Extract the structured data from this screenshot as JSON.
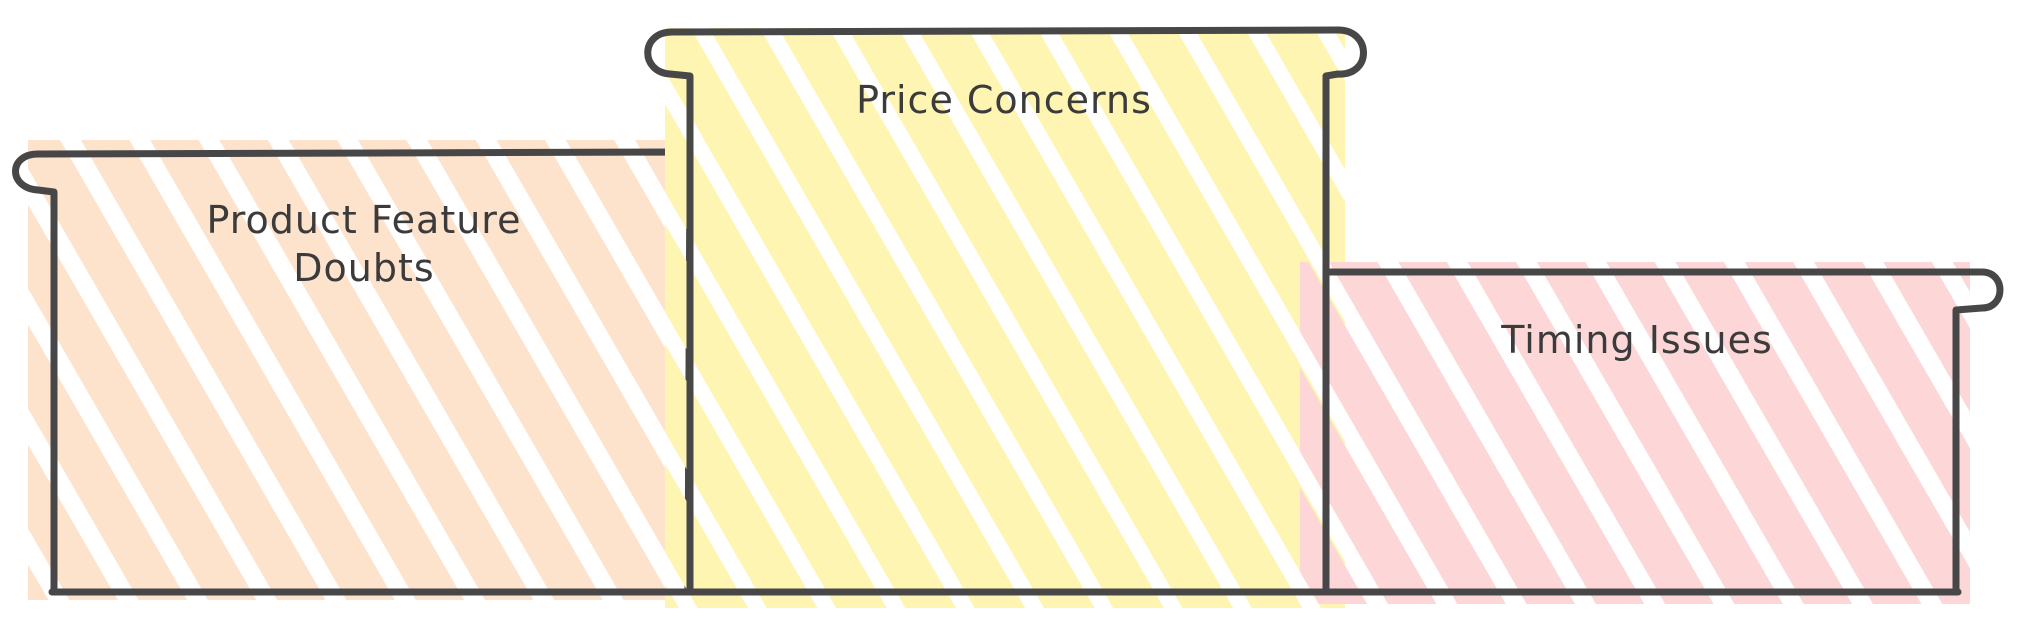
{
  "podium": [
    {
      "key": "left",
      "label": "Product Feature\nDoubts",
      "rank": 2,
      "fill": "#fde2cc"
    },
    {
      "key": "center",
      "label": "Price Concerns",
      "rank": 1,
      "fill": "#fff5b2"
    },
    {
      "key": "right",
      "label": "Timing Issues",
      "rank": 3,
      "fill": "#fdd7d7"
    }
  ],
  "colors": {
    "outline": "#474747",
    "text": "#3b3b3b",
    "background": "#ffffff"
  }
}
